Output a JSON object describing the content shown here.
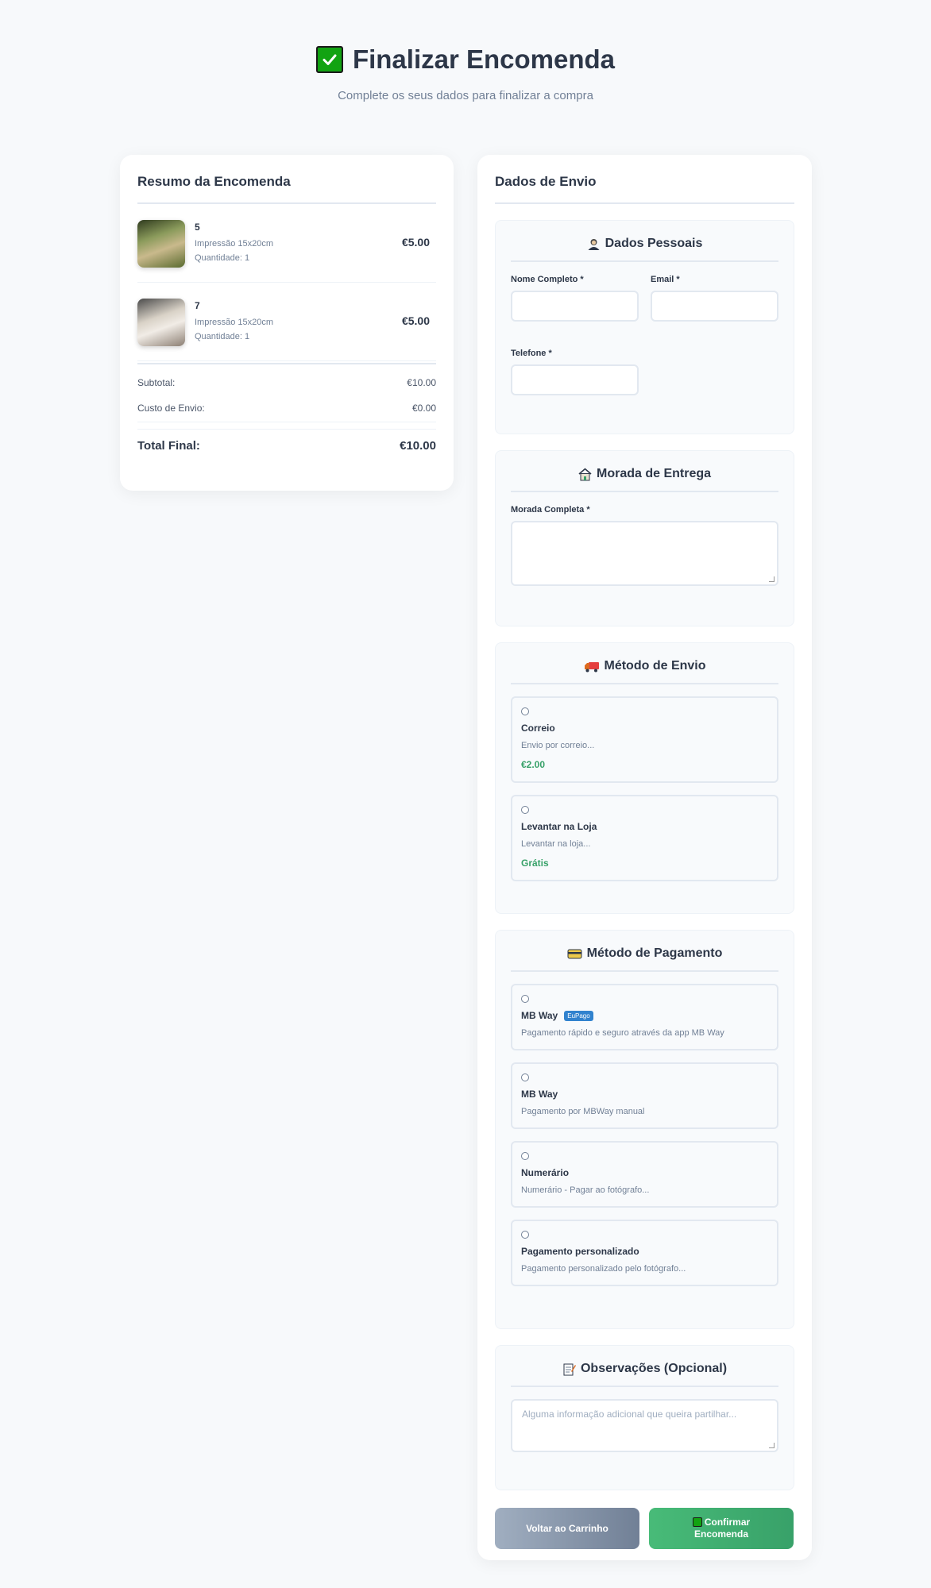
{
  "header": {
    "title": "Finalizar Encomenda",
    "subtitle": "Complete os seus dados para finalizar a compra",
    "icon": "check-mark-icon"
  },
  "summary": {
    "title": "Resumo da Encomenda",
    "items": [
      {
        "name": "5",
        "format": "Impressão 15x20cm",
        "quantity": "Quantidade: 1",
        "price": "€5.00"
      },
      {
        "name": "7",
        "format": "Impressão 15x20cm",
        "quantity": "Quantidade: 1",
        "price": "€5.00"
      }
    ],
    "subtotal_label": "Subtotal:",
    "subtotal_value": "€10.00",
    "shipping_label": "Custo de Envio:",
    "shipping_value": "€0.00",
    "total_label": "Total Final:",
    "total_value": "€10.00"
  },
  "shipping": {
    "title": "Dados de Envio",
    "personal": {
      "title": "Dados Pessoais",
      "name_label": "Nome Completo *",
      "name_value": "",
      "email_label": "Email *",
      "email_value": "",
      "phone_label": "Telefone *",
      "phone_value": ""
    },
    "address": {
      "title": "Morada de Entrega",
      "label": "Morada Completa *",
      "value": ""
    },
    "method": {
      "title": "Método de Envio",
      "options": [
        {
          "name": "Correio",
          "desc": "Envio por correio...",
          "price": "€2.00"
        },
        {
          "name": "Levantar na Loja",
          "desc": "Levantar na loja...",
          "price": "Grátis"
        }
      ]
    },
    "payment": {
      "title": "Método de Pagamento",
      "options": [
        {
          "name": "MB Way",
          "badge": "EuPago",
          "desc": "Pagamento rápido e seguro através da app MB Way"
        },
        {
          "name": "MB Way",
          "desc": "Pagamento por MBWay manual"
        },
        {
          "name": "Numerário",
          "desc": "Numerário - Pagar ao fotógrafo..."
        },
        {
          "name": "Pagamento personalizado",
          "desc": "Pagamento personalizado pelo fotógrafo..."
        }
      ]
    },
    "notes": {
      "title": "Observações (Opcional)",
      "placeholder": "Alguma informação adicional que queira partilhar..."
    }
  },
  "actions": {
    "back_label": "Voltar ao Carrinho",
    "confirm_label": "Confirmar Encomenda"
  },
  "colors": {
    "accent_green": "#48bb78",
    "price_green": "#38a169",
    "badge_blue": "#3182ce",
    "back_gray": "#718096"
  }
}
